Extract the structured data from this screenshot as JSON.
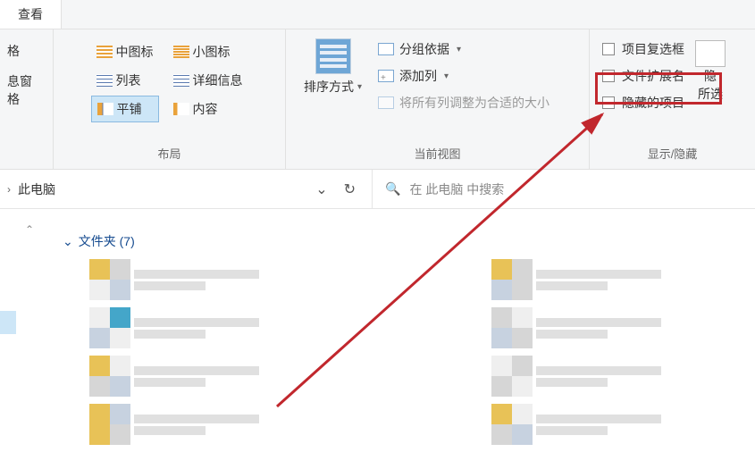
{
  "tab": {
    "view": "查看"
  },
  "left_panel": {
    "item1": "格",
    "item2": "息窗格"
  },
  "layout": {
    "medium_icons": "中图标",
    "small_icons": "小图标",
    "list": "列表",
    "details": "详细信息",
    "tiles": "平铺",
    "content": "内容",
    "group_label": "布局"
  },
  "current_view": {
    "sort": "排序方式",
    "group_by": "分组依据",
    "add_columns": "添加列",
    "fit_columns": "将所有列调整为合适的大小",
    "group_label": "当前视图"
  },
  "show_hide": {
    "item_checkboxes": "项目复选框",
    "file_ext": "文件扩展名",
    "hidden_items": "隐藏的项目",
    "group_label": "显示/隐藏",
    "hide_selected_top": "隐",
    "hide_selected_bottom": "所选"
  },
  "nav": {
    "location": "此电脑",
    "search_placeholder": "在 此电脑 中搜索"
  },
  "content": {
    "folders_label": "文件夹 (7)"
  }
}
